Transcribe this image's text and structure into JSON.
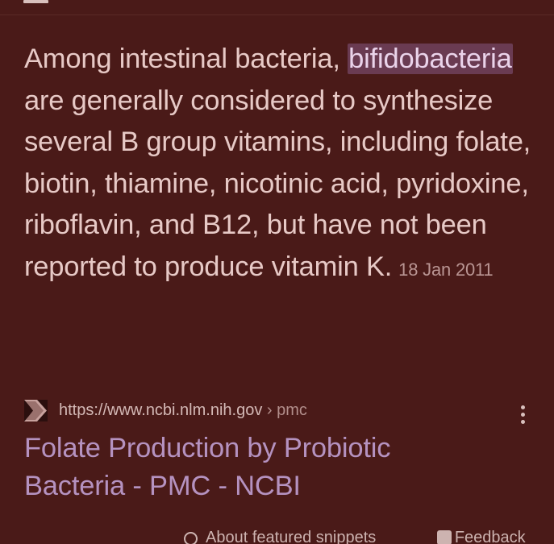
{
  "snippet": {
    "before_highlight": "Among intestinal bacteria, ",
    "highlight": "bifidobacteria",
    "after_highlight": " are generally considered to synthesize several B group vitamins, including folate, biotin, thiamine, nicotinic acid, pyridoxine, riboflavin, and B12, but have not been reported to produce vitamin K.",
    "date": "18 Jan 2011"
  },
  "result": {
    "favicon": "ncbi-chevron-icon",
    "url_domain": "https://www.ncbi.nlm.nih.gov",
    "url_path": " › pmc",
    "title": "Folate Production by Probiotic Bacteria - PMC - NCBI"
  },
  "footer": {
    "about_label": "About featured snippets",
    "feedback_label": "Feedback"
  },
  "colors": {
    "background": "#4a1a18",
    "text": "#e7c9c6",
    "highlight_bg": "#6a3b52",
    "link": "#b592c0"
  }
}
